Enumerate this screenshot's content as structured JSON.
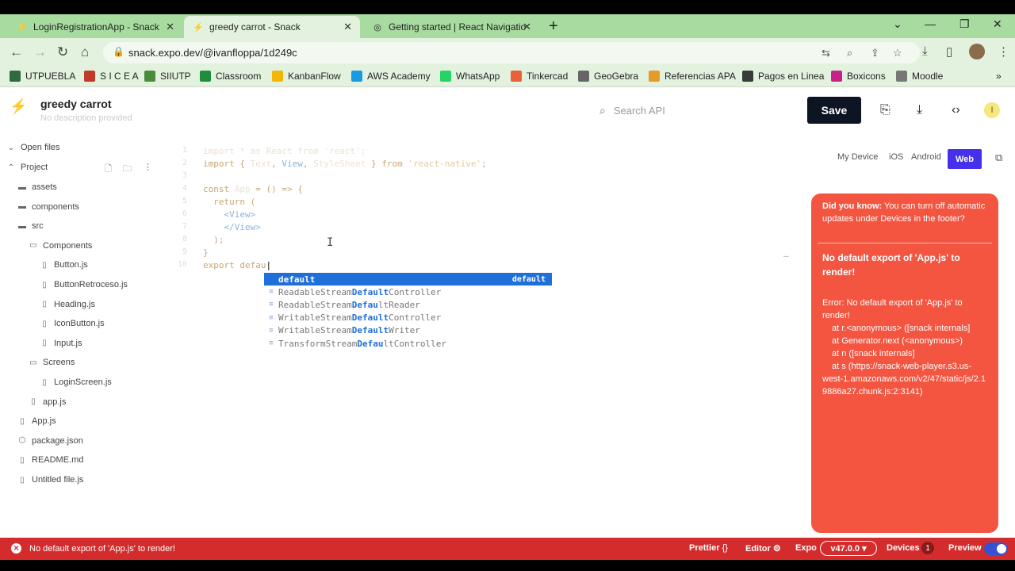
{
  "browser": {
    "tabs": [
      {
        "title": "LoginRegistrationApp - Snack",
        "active": false
      },
      {
        "title": "greedy carrot - Snack",
        "active": true
      },
      {
        "title": "Getting started | React Navigatio",
        "active": false
      }
    ],
    "url": "snack.expo.dev/@ivanfloppa/1d249c",
    "bookmarks": [
      {
        "label": "UTPUEBLA",
        "color": "#2d6a3e"
      },
      {
        "label": "S I C E A",
        "color": "#c0392b"
      },
      {
        "label": "SIIUTP",
        "color": "#4a8c3a"
      },
      {
        "label": "Classroom",
        "color": "#1e8e3e"
      },
      {
        "label": "KanbanFlow",
        "color": "#f2b705"
      },
      {
        "label": "AWS Academy",
        "color": "#1a9ae0"
      },
      {
        "label": "WhatsApp",
        "color": "#25d366"
      },
      {
        "label": "Tinkercad",
        "color": "#e8613a"
      },
      {
        "label": "GeoGebra",
        "color": "#666666"
      },
      {
        "label": "Referencias APA",
        "color": "#e39b2a"
      },
      {
        "label": "Pagos en Linea",
        "color": "#3a3a3a"
      },
      {
        "label": "Boxicons",
        "color": "#c7228a"
      },
      {
        "label": "Moodle",
        "color": "#777777"
      }
    ]
  },
  "header": {
    "title": "greedy carrot",
    "subtitle": "No description provided",
    "search_placeholder": "Search API",
    "save_label": "Save",
    "user_initial": "I"
  },
  "sidebar": {
    "open_files": "Open files",
    "project": "Project",
    "tree": [
      {
        "label": "assets",
        "type": "folder",
        "depth": 1
      },
      {
        "label": "components",
        "type": "folder",
        "depth": 1
      },
      {
        "label": "src",
        "type": "folder",
        "depth": 1
      },
      {
        "label": "Components",
        "type": "folder-open",
        "depth": 2
      },
      {
        "label": "Button.js",
        "type": "file",
        "depth": 3
      },
      {
        "label": "ButtonRetroceso.js",
        "type": "file",
        "depth": 3
      },
      {
        "label": "Heading.js",
        "type": "file",
        "depth": 3
      },
      {
        "label": "IconButton.js",
        "type": "file",
        "depth": 3
      },
      {
        "label": "Input.js",
        "type": "file",
        "depth": 3
      },
      {
        "label": "Screens",
        "type": "folder-open",
        "depth": 2
      },
      {
        "label": "LoginScreen.js",
        "type": "file",
        "depth": 3
      },
      {
        "label": "app.js",
        "type": "file",
        "depth": 2
      },
      {
        "label": "App.js",
        "type": "file",
        "depth": 1
      },
      {
        "label": "package.json",
        "type": "package",
        "depth": 1
      },
      {
        "label": "README.md",
        "type": "file",
        "depth": 1
      },
      {
        "label": "Untitled file.js",
        "type": "file",
        "depth": 1
      }
    ]
  },
  "editor": {
    "line_numbers": [
      "1",
      "2",
      "3",
      "4",
      "5",
      "6",
      "7",
      "8",
      "9",
      "10"
    ],
    "autocomplete": [
      {
        "prefix": "",
        "match": "default",
        "suffix": "",
        "type": "default",
        "selected": true
      },
      {
        "prefix": "ReadableStream",
        "match": "Default",
        "suffix": "Controller",
        "type": "",
        "selected": false
      },
      {
        "prefix": "ReadableStream",
        "match": "Defau",
        "suffix": "ltReader",
        "type": "",
        "selected": false
      },
      {
        "prefix": "WritableStream",
        "match": "Default",
        "suffix": "Controller",
        "type": "",
        "selected": false
      },
      {
        "prefix": "WritableStream",
        "match": "Default",
        "suffix": "Writer",
        "type": "",
        "selected": false
      },
      {
        "prefix": "TransformStream",
        "match": "Defau",
        "suffix": "ltController",
        "type": "",
        "selected": false
      }
    ]
  },
  "device": {
    "tabs": [
      "My Device",
      "iOS",
      "Android"
    ],
    "active_tab": "Web",
    "tip_bold": "Did you know:",
    "tip_text": " You can turn off automatic updates under Devices in the footer?",
    "error_title": "No default export of 'App.js' to render!",
    "error_line1": "Error: No default export of 'App.js' to render!",
    "error_trace": [
      "at r.<anonymous> ([snack internals]",
      "at Generator.next (<anonymous>)",
      "at n ([snack internals]",
      "at s (https://snack-web-player.s3.us-"
    ],
    "error_trace_tail": "west-1.amazonaws.com/v2/47/static/js/2.19886a27.chunk.js:2:3141)"
  },
  "status": {
    "message": "No default export of 'App.js' to render!",
    "prettier": "Prettier",
    "editor": "Editor",
    "expo": "Expo",
    "sdk": "v47.0.0",
    "devices": "Devices",
    "devices_count": "1",
    "preview": "Preview"
  },
  "colors": {
    "accent": "#4630eb",
    "error": "#f35541",
    "statusbar": "#d42c2c",
    "browser_chrome": "#a8dba0"
  }
}
